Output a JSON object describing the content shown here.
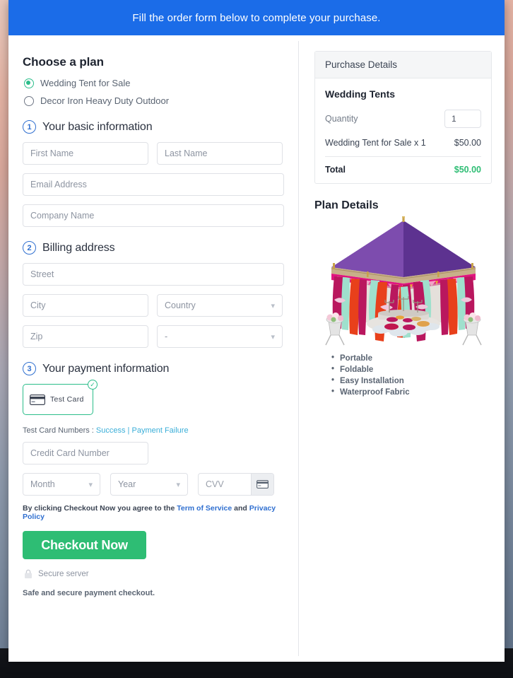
{
  "banner": {
    "text": "Fill the order form below to complete your purchase."
  },
  "plan": {
    "heading": "Choose a plan",
    "options": [
      {
        "label": "Wedding Tent for Sale",
        "selected": true
      },
      {
        "label": "Decor Iron Heavy Duty Outdoor",
        "selected": false
      }
    ]
  },
  "steps": {
    "basic": {
      "num": "1",
      "title": "Your basic information"
    },
    "billing": {
      "num": "2",
      "title": "Billing address"
    },
    "payment": {
      "num": "3",
      "title": "Your payment information"
    }
  },
  "fields": {
    "first_name": "First Name",
    "last_name": "Last Name",
    "email": "Email Address",
    "company": "Company Name",
    "street": "Street",
    "city": "City",
    "country": "Country",
    "zip": "Zip",
    "state": "-",
    "card_number": "Credit Card Number",
    "month": "Month",
    "year": "Year",
    "cvv": "CVV"
  },
  "payment": {
    "method_label": "Test Card",
    "method_selected": true,
    "test_numbers_prefix": "Test Card Numbers : ",
    "test_success": "Success",
    "test_separator": " | ",
    "test_failure": "Payment Failure"
  },
  "footer": {
    "terms_prefix": "By clicking Checkout Now you agree to the ",
    "terms_link": "Term of Service",
    "terms_and": " and ",
    "privacy_link": "Privacy Policy",
    "checkout_label": "Checkout Now",
    "secure_server": "Secure server",
    "safe_text": "Safe and secure payment checkout."
  },
  "purchase": {
    "panel_header": "Purchase Details",
    "product_title": "Wedding Tents",
    "quantity_label": "Quantity",
    "quantity_value": "1",
    "line_item": "Wedding Tent for Sale x 1",
    "line_price": "$50.00",
    "total_label": "Total",
    "total_price": "$50.00"
  },
  "plan_details": {
    "title": "Plan Details",
    "image_alt": "wedding-tent-image",
    "features": [
      "Portable",
      "Foldable",
      "Easy Installation",
      "Waterproof Fabric"
    ]
  },
  "colors": {
    "banner_blue": "#1b6ce8",
    "accent_green": "#2ebd74",
    "radio_green": "#2bbd8a",
    "step_blue": "#2f6fd0",
    "link_blue": "#2f6fd0",
    "test_link": "#3aaed8"
  }
}
